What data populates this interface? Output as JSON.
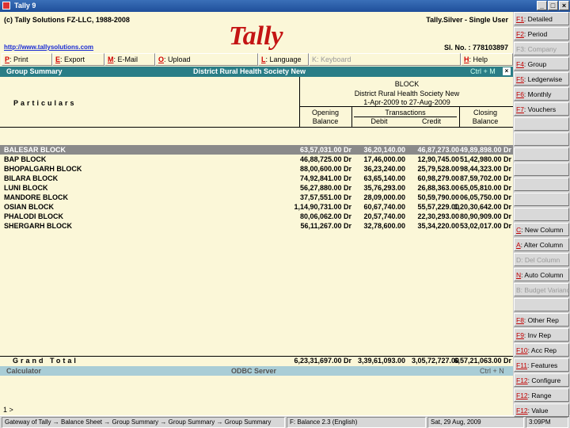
{
  "window": {
    "title": "Tally 9",
    "minimize": "_",
    "maximize": "□",
    "close": "×"
  },
  "header": {
    "copyright": "(c) Tally Solutions FZ-LLC, 1988-2008",
    "url": "http://www.tallysolutions.com",
    "edition": "Tally.Silver - Single User",
    "serial": "Sl. No. : 778103897",
    "logo_text": "Tally"
  },
  "menubar": [
    {
      "key": "P",
      "label": ": Print"
    },
    {
      "key": "E",
      "label": ": Export"
    },
    {
      "key": "M",
      "label": ": E-Mail"
    },
    {
      "key": "O",
      "label": ": Upload"
    },
    {
      "key": "L",
      "label": ": Language"
    },
    {
      "key": "K",
      "label": ": Keyboard"
    },
    {
      "key": "H",
      "label": ": Help"
    }
  ],
  "infobar": {
    "left": "Group Summary",
    "center": "District Rural Health Society New",
    "right": "Ctrl + M",
    "close": "×"
  },
  "report": {
    "particulars": "Particulars",
    "heading1": "BLOCK",
    "heading2": "District Rural Health Society New",
    "period": "1-Apr-2009 to 27-Aug-2009",
    "opening_1": "Opening",
    "opening_2": "Balance",
    "transactions": "Transactions",
    "debit": "Debit",
    "credit": "Credit",
    "closing_1": "Closing",
    "closing_2": "Balance",
    "rows": [
      {
        "name": "BALESAR BLOCK",
        "opening": "63,57,031.00 Dr",
        "debit": "36,20,140.00",
        "credit": "46,87,273.00",
        "closing": "49,89,898.00 Dr"
      },
      {
        "name": "BAP BLOCK",
        "opening": "46,88,725.00 Dr",
        "debit": "17,46,000.00",
        "credit": "12,90,745.00",
        "closing": "51,42,980.00 Dr"
      },
      {
        "name": "BHOPALGARH BLOCK",
        "opening": "88,00,600.00 Dr",
        "debit": "36,23,240.00",
        "credit": "25,79,528.00",
        "closing": "98,44,323.00 Dr"
      },
      {
        "name": "BILARA BLOCK",
        "opening": "74,92,841.00 Dr",
        "debit": "63,65,140.00",
        "credit": "60,98,279.00",
        "closing": "87,59,702.00 Dr"
      },
      {
        "name": "LUNI BLOCK",
        "opening": "56,27,880.00 Dr",
        "debit": "35,76,293.00",
        "credit": "26,88,363.00",
        "closing": "65,05,810.00 Dr"
      },
      {
        "name": "MANDORE BLOCK",
        "opening": "37,57,551.00 Dr",
        "debit": "28,09,000.00",
        "credit": "50,59,790.00",
        "closing": "06,05,750.00 Dr"
      },
      {
        "name": "OSIAN BLOCK",
        "opening": "1,14,90,731.00 Dr",
        "debit": "60,67,740.00",
        "credit": "55,57,229.00",
        "closing": "1,20,30,642.00 Dr"
      },
      {
        "name": "PHALODI BLOCK",
        "opening": "80,06,062.00 Dr",
        "debit": "20,57,740.00",
        "credit": "22,30,293.00",
        "closing": "80,90,909.00 Dr"
      },
      {
        "name": "SHERGARH BLOCK",
        "opening": "56,11,267.00 Dr",
        "debit": "32,78,600.00",
        "credit": "35,34,220.00",
        "closing": "53,02,017.00 Dr"
      }
    ],
    "total_label": "Grand Total",
    "total_opening": "6,23,31,697.00 Dr",
    "total_debit": "3,39,61,093.00",
    "total_credit": "3,05,72,727.00",
    "total_closing": "6,57,21,063.00 Dr"
  },
  "calculator": {
    "label": "Calculator",
    "center": "ODBC Server",
    "right": "Ctrl + N",
    "prompt": "1 >"
  },
  "statusbar": [
    "Gateway of Tally → Balance Sheet → Group Summary → Group Summary → Group Summary",
    "F: Balance 2.3 (English)",
    "Sat, 29 Aug, 2009",
    "3:09PM"
  ],
  "rightpanel": [
    {
      "key": "F1",
      "label": ": Detailed",
      "dim": false
    },
    {
      "key": "F2",
      "label": ": Period",
      "dim": false
    },
    {
      "key": "F3",
      "label": ": Company",
      "dim": true
    },
    {
      "key": "F4",
      "label": ": Group",
      "dim": false
    },
    {
      "key": "F5",
      "label": ": Ledgerwise",
      "dim": false
    },
    {
      "key": "F6",
      "label": ": Monthly",
      "dim": false
    },
    {
      "key": "F7",
      "label": ": Vouchers",
      "dim": false
    },
    {
      "key": "",
      "label": "",
      "dim": true
    },
    {
      "key": "",
      "label": "",
      "dim": true
    },
    {
      "key": "",
      "label": "",
      "dim": true
    },
    {
      "key": "",
      "label": "",
      "dim": true
    },
    {
      "key": "",
      "label": "",
      "dim": true
    },
    {
      "key": "",
      "label": "",
      "dim": true
    },
    {
      "key": "",
      "label": "",
      "dim": true
    },
    {
      "key": "C",
      "label": ": New Column",
      "dim": false
    },
    {
      "key": "A",
      "label": ": Alter Column",
      "dim": false
    },
    {
      "key": "D",
      "label": ": Del Column",
      "dim": true
    },
    {
      "key": "N",
      "label": ": Auto Column",
      "dim": false
    },
    {
      "key": "B",
      "label": ": Budget Variance",
      "dim": true
    },
    {
      "key": "",
      "label": "",
      "dim": true
    },
    {
      "key": "F8",
      "label": ": Other Rep",
      "dim": false
    },
    {
      "key": "F9",
      "label": ": Inv Rep",
      "dim": false
    },
    {
      "key": "F10",
      "label": ": Acc Rep",
      "dim": false
    },
    {
      "key": "F11",
      "label": ": Features",
      "dim": false
    },
    {
      "key": "F12",
      "label": ": Configure",
      "dim": false
    },
    {
      "key": "F12",
      "label": ": Range",
      "dim": false
    },
    {
      "key": "F12",
      "label": ": Value",
      "dim": false
    }
  ],
  "colors": {
    "background": "#fbf7d8",
    "infobar": "#2a7d86",
    "selection": "#8a8a8a",
    "hotkey": "#d10000",
    "logo": "#c41414"
  }
}
